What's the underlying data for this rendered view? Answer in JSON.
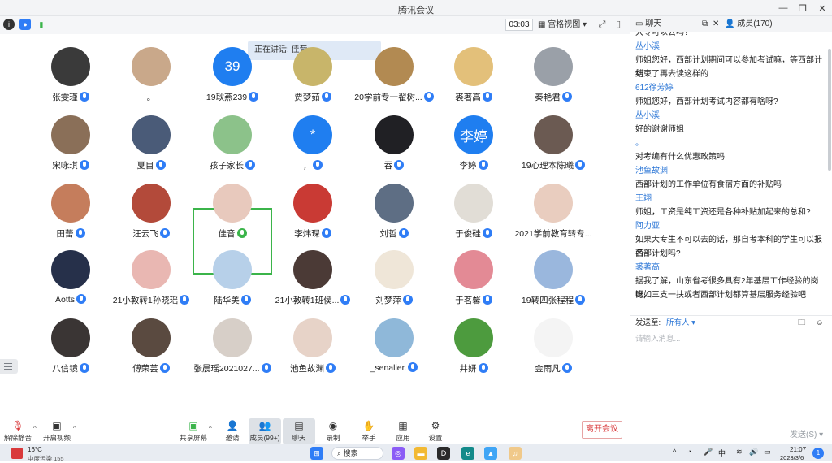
{
  "window": {
    "title": "腾讯会议"
  },
  "toolbar": {
    "timer": "03:03",
    "view_mode": "宫格视图"
  },
  "speaking": "正在讲话: 佳音;",
  "participants": [
    {
      "name": "张雯瑾",
      "avatar": "#3a3a3a",
      "mic": "blue"
    },
    {
      "name": "。",
      "avatar": "#c9a88a",
      "mic": "none"
    },
    {
      "name": "19耿燕239",
      "avatar": "#1f7ef0",
      "text": "39",
      "mic": "blue"
    },
    {
      "name": "贾梦茹",
      "avatar": "#c8b56a",
      "mic": "blue"
    },
    {
      "name": "20学前专一翟树...",
      "avatar": "#b28a52",
      "mic": "blue"
    },
    {
      "name": "裘著高",
      "avatar": "#e3c07a",
      "mic": "blue"
    },
    {
      "name": "秦艳君",
      "avatar": "#9aa0a8",
      "mic": "blue"
    },
    {
      "name": "宋咏琪",
      "avatar": "#8a6f58",
      "mic": "blue"
    },
    {
      "name": "夏目",
      "avatar": "#4a5b78",
      "mic": "blue"
    },
    {
      "name": "孩子家长",
      "avatar": "#8cc28a",
      "mic": "blue"
    },
    {
      "name": "，",
      "avatar": "#1f7ef0",
      "text": "*",
      "mic": "blue"
    },
    {
      "name": "吞",
      "avatar": "#202024",
      "mic": "blue"
    },
    {
      "name": "李婷",
      "avatar": "#1f7ef0",
      "text": "李婷",
      "mic": "blue"
    },
    {
      "name": "19心理本陈曦",
      "avatar": "#6b5a52",
      "mic": "blue"
    },
    {
      "name": "田蕾",
      "avatar": "#c57d5c",
      "mic": "blue"
    },
    {
      "name": "汪云飞",
      "avatar": "#b34a3a",
      "mic": "blue"
    },
    {
      "name": "佳音",
      "avatar": "#e8c9bd",
      "mic": "green"
    },
    {
      "name": "李炜琛",
      "avatar": "#c93a34",
      "mic": "blue"
    },
    {
      "name": "刘哲",
      "avatar": "#5e6e84",
      "mic": "blue"
    },
    {
      "name": "于俊硅",
      "avatar": "#e1ddd6",
      "mic": "blue"
    },
    {
      "name": "2021学前教育转专...",
      "avatar": "#e9cdbf",
      "mic": "none"
    },
    {
      "name": "Aotts",
      "avatar": "#26304a",
      "mic": "blue"
    },
    {
      "name": "21小教转1孙晓瑶",
      "avatar": "#e9b7b2",
      "mic": "blue"
    },
    {
      "name": "陆华美",
      "avatar": "#b7d0e9",
      "mic": "blue"
    },
    {
      "name": "21小教转1班侯...",
      "avatar": "#4b3a36",
      "mic": "blue"
    },
    {
      "name": "刘梦萍",
      "avatar": "#efe6d8",
      "mic": "blue"
    },
    {
      "name": "于茗馨",
      "avatar": "#e38a95",
      "mic": "blue"
    },
    {
      "name": "19转四张程程",
      "avatar": "#9ab7dd",
      "mic": "blue"
    },
    {
      "name": "八信镜",
      "avatar": "#3a3534",
      "mic": "blue"
    },
    {
      "name": "傅荣芸",
      "avatar": "#5a4a40",
      "mic": "blue"
    },
    {
      "name": "张晨瑶2021027...",
      "avatar": "#d7cfc8",
      "mic": "blue"
    },
    {
      "name": "池鱼故渊",
      "avatar": "#e7d3c8",
      "mic": "blue"
    },
    {
      "name": "_senalier.",
      "avatar": "#8fb8d9",
      "mic": "blue"
    },
    {
      "name": "井妍",
      "avatar": "#4d9b3e",
      "mic": "blue"
    },
    {
      "name": "金雨凡",
      "avatar": "#f4f4f4",
      "mic": "blue"
    }
  ],
  "bottom": {
    "unmute": "解除静音",
    "video": "开启视频",
    "share": "共享屏幕",
    "invite": "邀请",
    "members": "成员(99+)",
    "chat": "聊天",
    "record": "录制",
    "raise": "举手",
    "apps": "应用",
    "settings": "设置",
    "leave": "离开会议"
  },
  "panel": {
    "chat_tab": "聊天",
    "members_tab": "成员(170)",
    "send_to_label": "发送至:",
    "send_to_value": "所有人",
    "placeholder": "请输入消息...",
    "send_button": "发送(S)"
  },
  "chat": [
    {
      "type": "text",
      "text": "大专可以去吗?"
    },
    {
      "type": "sender",
      "text": "丛小溪"
    },
    {
      "type": "text",
      "text": "师姐您好，西部计划期间可以参加考试嘛，等西部计划"
    },
    {
      "type": "text",
      "text": "结束了再去读这样的"
    },
    {
      "type": "sender",
      "text": "612徐芳婷"
    },
    {
      "type": "text",
      "text": "师姐您好，西部计划考试内容都有啥呀?"
    },
    {
      "type": "sender",
      "text": "丛小溪"
    },
    {
      "type": "text",
      "text": "好的谢谢师姐"
    },
    {
      "type": "sender",
      "text": "。"
    },
    {
      "type": "text",
      "text": "对考编有什么优惠政策吗"
    },
    {
      "type": "sender",
      "text": "池鱼故渊"
    },
    {
      "type": "text",
      "text": "西部计划的工作单位有食宿方面的补贴吗"
    },
    {
      "type": "sender",
      "text": "王翊"
    },
    {
      "type": "text",
      "text": "师姐，工资是纯工资还是各种补贴加起来的总和?"
    },
    {
      "type": "sender",
      "text": "阿力亚"
    },
    {
      "type": "text",
      "text": "如果大专生不可以去的话，那自考本科的学生可以报名"
    },
    {
      "type": "text",
      "text": "西部计划吗?"
    },
    {
      "type": "sender",
      "text": "裘著高"
    },
    {
      "type": "text",
      "text": "据我了解，山东省考很多具有2年基层工作经验的岗呀,"
    },
    {
      "type": "text",
      "text": "比如三支一扶或者西部计划都算基层服务经验吧"
    }
  ],
  "taskbar": {
    "weather_temp": "16°C",
    "weather_desc": "中度污染 155",
    "search": "搜索",
    "ime": "中",
    "time": "21:07",
    "date": "2023/3/6"
  }
}
